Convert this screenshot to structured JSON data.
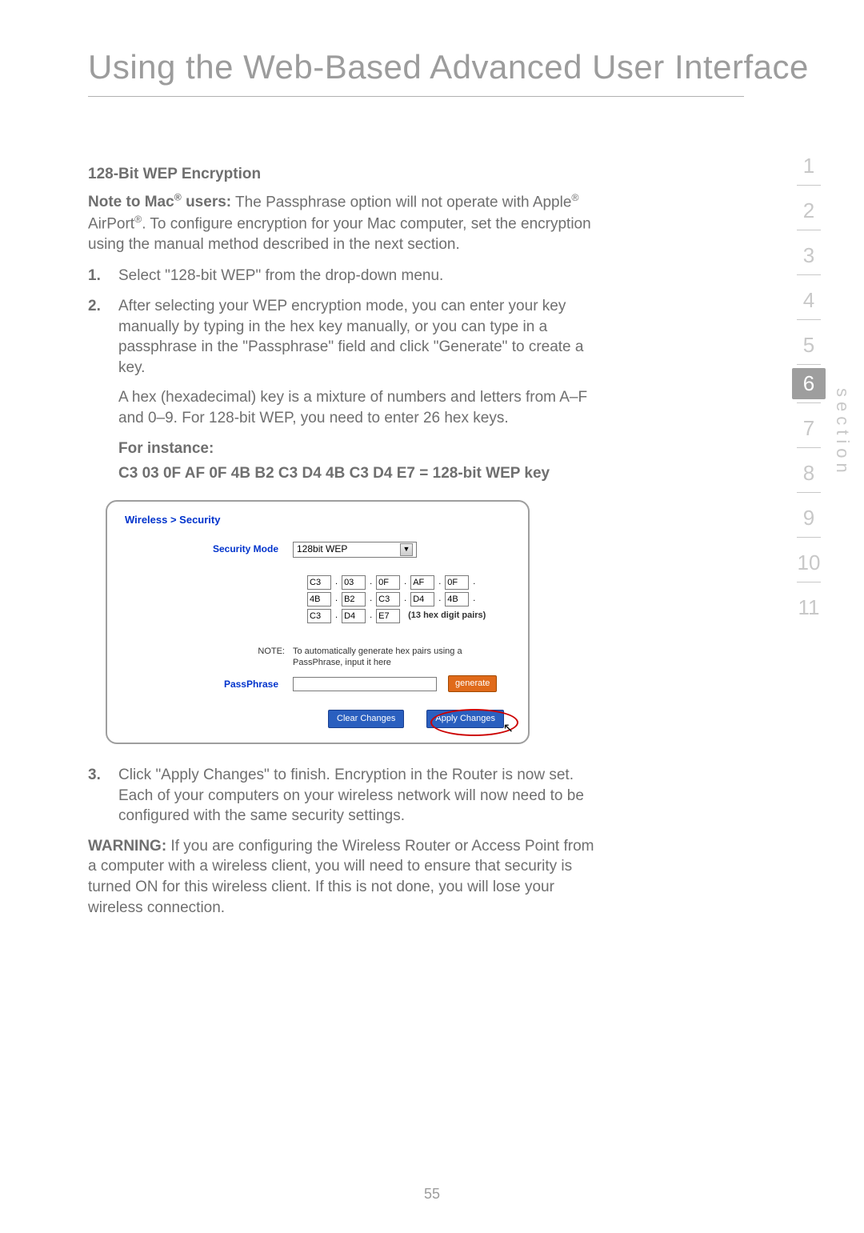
{
  "page_title": "Using the Web-Based Advanced User Interface",
  "heading": "128-Bit WEP Encryption",
  "note_mac_label": "Note to Mac",
  "note_mac_suffix": " users:",
  "note_mac_body": " The Passphrase option will not operate with Apple",
  "note_mac_body2": " AirPort",
  "note_mac_body3": ". To configure encryption for your Mac computer, set the encryption using the manual method described in the next section.",
  "step1_num": "1.",
  "step1": "Select \"128-bit WEP\" from the drop-down menu.",
  "step2_num": "2.",
  "step2a": "After selecting your WEP encryption mode, you can enter your key manually by typing in the hex key manually, or you can type in a passphrase in the \"Passphrase\" field and click \"Generate\" to create a key.",
  "step2b": "A hex (hexadecimal) key is a mixture of numbers and letters from A–F and 0–9. For 128-bit WEP, you need to enter 26 hex keys.",
  "for_instance": "For instance:",
  "key_example": "C3 03 0F AF 0F 4B B2 C3 D4 4B C3 D4 E7 = 128-bit WEP key",
  "step3_num": "3.",
  "step3": "Click \"Apply Changes\" to finish. Encryption in the Router is now set. Each of your computers on your wireless network will now need to be configured with the same security settings.",
  "warning_label": "WARNING:",
  "warning_body": " If you are configuring the Wireless Router or Access Point from a computer with a wireless client, you will need to ensure that security is turned ON for this wireless client. If this is not done, you will lose your wireless connection.",
  "page_number": "55",
  "nav": {
    "items": [
      "1",
      "2",
      "3",
      "4",
      "5",
      "6",
      "7",
      "8",
      "9",
      "10",
      "11"
    ],
    "active_index": 5,
    "label": "section"
  },
  "figure": {
    "breadcrumb": "Wireless > Security",
    "security_mode_label": "Security Mode",
    "security_mode_value": "128bit WEP",
    "hex": [
      [
        "C3",
        "03",
        "0F",
        "AF",
        "0F"
      ],
      [
        "4B",
        "B2",
        "C3",
        "D4",
        "4B"
      ],
      [
        "C3",
        "D4",
        "E7"
      ]
    ],
    "hex_note": "(13 hex digit pairs)",
    "note_label": "NOTE:",
    "note_text": "To automatically generate hex pairs using a PassPhrase, input it here",
    "passphrase_label": "PassPhrase",
    "generate_btn": "generate",
    "clear_btn": "Clear Changes",
    "apply_btn": "Apply Changes"
  }
}
